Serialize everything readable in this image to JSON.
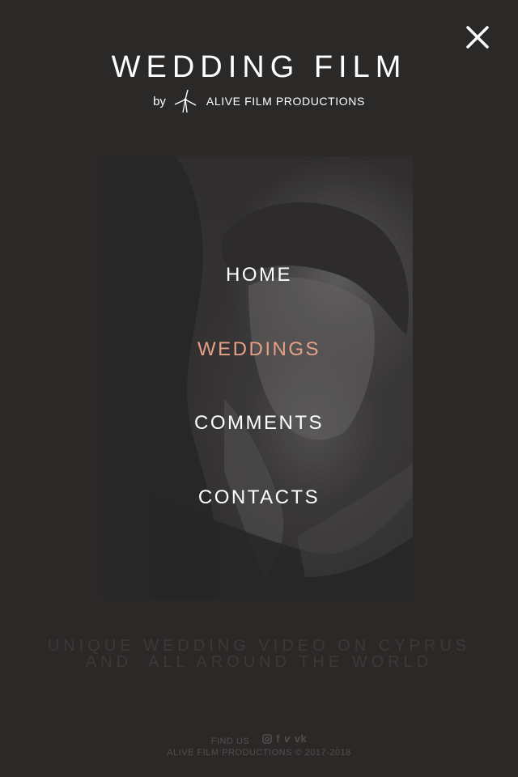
{
  "header": {
    "close_icon": "close-icon",
    "title": "WEDDING FILM",
    "by_text": "by",
    "logo_icon": "windmill-logo-icon",
    "company": "ALIVE FILM PRODUCTIONS"
  },
  "menu": {
    "items": [
      {
        "label": "HOME",
        "active": false
      },
      {
        "label": "WEDDINGS",
        "active": true
      },
      {
        "label": "COMMENTS",
        "active": false
      },
      {
        "label": "CONTACTS",
        "active": false
      }
    ]
  },
  "tagline": {
    "line1": "UNIQUE WEDDING VIDEO ON CYPRUS",
    "line2": "AND  ALL AROUND THE WORLD"
  },
  "footer": {
    "find_us": "FIND US",
    "social": [
      {
        "name": "instagram-icon"
      },
      {
        "name": "facebook-icon",
        "glyph": "f"
      },
      {
        "name": "vimeo-icon",
        "glyph": "v"
      },
      {
        "name": "vk-icon",
        "glyph": "vk"
      }
    ],
    "copyright": "ALIVE FILM PRODUCTIONS © 2017-2018"
  },
  "colors": {
    "background": "#2b2828",
    "accent": "#e7a086",
    "text": "#ffffff",
    "muted": "#524e4e"
  }
}
